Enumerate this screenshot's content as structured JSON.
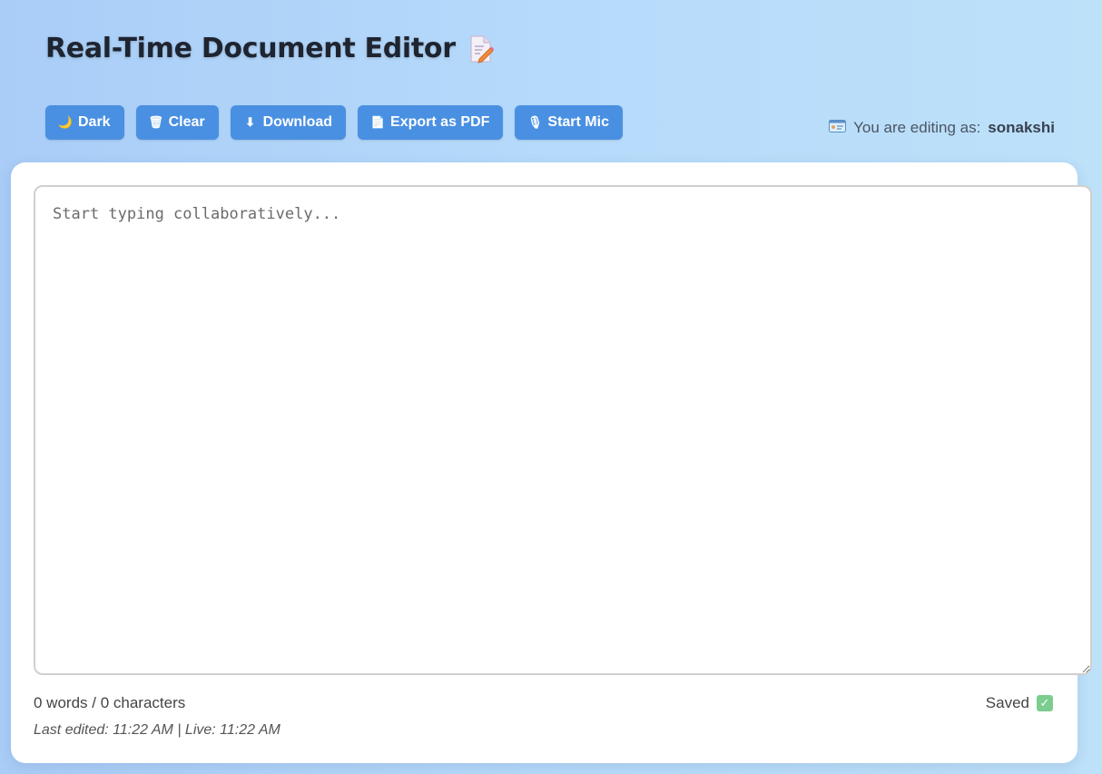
{
  "app": {
    "title": "Real-Time Document Editor",
    "title_icon": "memo-icon"
  },
  "toolbar": {
    "buttons": [
      {
        "label": "Dark",
        "icon": "moon-icon",
        "glyph": "🌙"
      },
      {
        "label": "Clear",
        "icon": "trash-icon",
        "glyph": "🗑"
      },
      {
        "label": "Download",
        "icon": "download-arrow-icon",
        "glyph": "⬇"
      },
      {
        "label": "Export as PDF",
        "icon": "document-icon",
        "glyph": "📄"
      },
      {
        "label": "Start Mic",
        "icon": "microphone-icon",
        "glyph": "🎙"
      }
    ],
    "button_color": "#4a90e2"
  },
  "user": {
    "prefix": "You are editing as:",
    "name": "sonakshi",
    "icon": "id-card-icon"
  },
  "editor": {
    "value": "",
    "placeholder": "Start typing collaboratively..."
  },
  "status": {
    "counts": "0 words / 0 characters",
    "saved_label": "Saved",
    "saved_icon": "check-box-icon",
    "last_edited": "Last edited: 11:22 AM | Live: 11:22 AM"
  }
}
